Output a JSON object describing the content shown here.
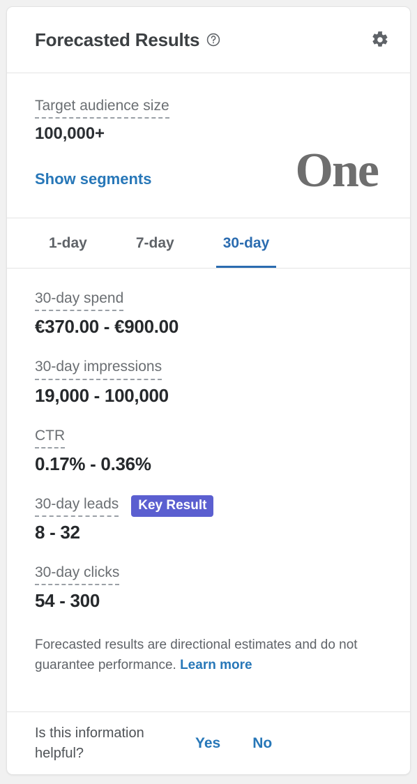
{
  "header": {
    "title": "Forecasted Results",
    "help_icon": "help-circle-icon",
    "settings_icon": "gear-icon"
  },
  "audience": {
    "label": "Target audience size",
    "value": "100,000+",
    "show_segments_link": "Show segments",
    "brand_logo_text": "One"
  },
  "tabs": [
    {
      "label": "1-day",
      "active": false
    },
    {
      "label": "7-day",
      "active": false
    },
    {
      "label": "30-day",
      "active": true
    }
  ],
  "metrics": [
    {
      "label": "30-day spend",
      "value": "€370.00 - €900.00",
      "badge": ""
    },
    {
      "label": "30-day impressions",
      "value": "19,000 - 100,000",
      "badge": ""
    },
    {
      "label": "CTR",
      "value": "0.17% - 0.36%",
      "badge": ""
    },
    {
      "label": "30-day leads",
      "value": "8 - 32",
      "badge": "Key Result"
    },
    {
      "label": "30-day clicks",
      "value": "54 - 300",
      "badge": ""
    }
  ],
  "disclaimer": {
    "text": "Forecasted results are directional estimates and do not guarantee performance.",
    "link": "Learn more"
  },
  "footer": {
    "question": "Is this information helpful?",
    "yes_label": "Yes",
    "no_label": "No"
  },
  "colors": {
    "accent_blue": "#2b6cb0",
    "link_blue": "#2777b8",
    "badge_purple": "#5b5fd0",
    "label_gray": "#6b6f73",
    "value_dark": "#26292c",
    "border_gray": "#e4e4e4",
    "canvas_gray": "#f1f1f1",
    "logo_gray": "#6e6e6e"
  }
}
